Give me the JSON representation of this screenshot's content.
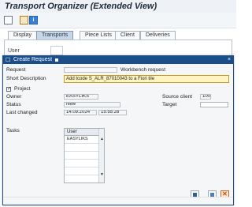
{
  "background": {
    "title": "Transport Organizer (Extended View)",
    "tabs": [
      "Display",
      "Transports",
      "Piece Lists",
      "Client",
      "Deliveries"
    ],
    "user_label": "User"
  },
  "dialog": {
    "title": "Create Request",
    "fields": {
      "request_label": "Request",
      "request_value": "",
      "request_type": "Workbench request",
      "short_desc_label": "Short Description",
      "short_desc_value": "Add tcode S_ALR_87010043 to a Fiori tile",
      "project_label": "Project",
      "owner_label": "Owner",
      "owner_value": "EASYLIKS",
      "source_client_label": "Source client",
      "source_client_value": "100",
      "status_label": "Status",
      "status_value": "New",
      "target_label": "Target",
      "target_value": "",
      "last_changed_label": "Last changed",
      "last_changed_date": "14.09.2024",
      "last_changed_time": "15:55:26"
    },
    "tasks": {
      "label": "Tasks",
      "header": "User",
      "rows": [
        "EASYLIKS",
        "",
        "",
        "",
        "",
        ""
      ]
    }
  },
  "icons": {
    "new": "new-document-icon",
    "edit": "edit-icon",
    "info": "info-icon",
    "close": "close-icon",
    "save": "save-icon",
    "copy": "copy-icon",
    "cancel": "cancel-icon"
  }
}
